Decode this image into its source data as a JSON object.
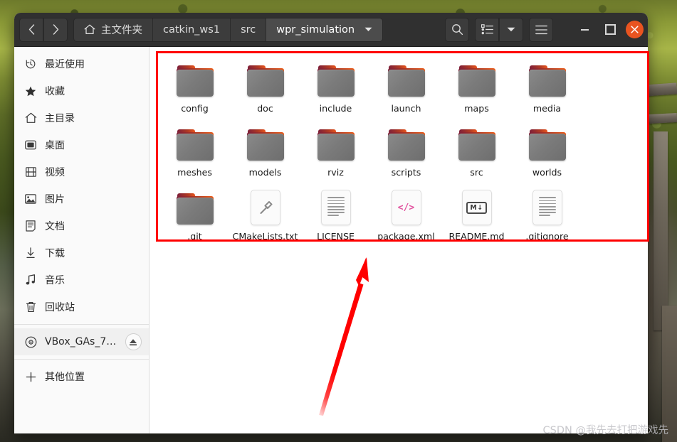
{
  "window": {
    "nav": {
      "back_label": "‹",
      "forward_label": "›"
    },
    "breadcrumb": [
      {
        "label": "主文件夹",
        "icon": "home-icon",
        "active": false
      },
      {
        "label": "catkin_ws1",
        "icon": "",
        "active": false
      },
      {
        "label": "src",
        "icon": "",
        "active": false
      },
      {
        "label": "wpr_simulation",
        "icon": "chevron-down-icon",
        "active": true
      }
    ],
    "toolbar": {
      "search_label": "search-icon",
      "view_list_label": "list-view-icon",
      "view_dropdown_label": "chevron-down-icon",
      "menu_label": "hamburger-menu-icon"
    },
    "controls": {
      "minimize_label": "minimize-icon",
      "maximize_label": "maximize-icon",
      "close_label": "close-icon",
      "close_color": "#e95420"
    }
  },
  "sidebar": {
    "items": [
      {
        "label": "最近使用",
        "icon": "clock-icon",
        "name": "recent"
      },
      {
        "label": "收藏",
        "icon": "star-icon",
        "name": "starred"
      },
      {
        "label": "主目录",
        "icon": "home-icon",
        "name": "home"
      },
      {
        "label": "桌面",
        "icon": "desktop-icon",
        "name": "desktop"
      },
      {
        "label": "视频",
        "icon": "video-icon",
        "name": "videos"
      },
      {
        "label": "图片",
        "icon": "image-icon",
        "name": "pictures"
      },
      {
        "label": "文档",
        "icon": "document-icon",
        "name": "documents"
      },
      {
        "label": "下载",
        "icon": "download-icon",
        "name": "downloads"
      },
      {
        "label": "音乐",
        "icon": "music-icon",
        "name": "music"
      },
      {
        "label": "回收站",
        "icon": "trash-icon",
        "name": "trash"
      }
    ],
    "drive": {
      "label": "VBox_GAs_7....",
      "icon": "disc-icon",
      "eject_label": "eject-icon"
    },
    "other_locations": {
      "label": "其他位置",
      "icon": "plus-icon"
    }
  },
  "files": [
    {
      "name": "config",
      "type": "folder"
    },
    {
      "name": "doc",
      "type": "folder"
    },
    {
      "name": "include",
      "type": "folder"
    },
    {
      "name": "launch",
      "type": "folder"
    },
    {
      "name": "maps",
      "type": "folder"
    },
    {
      "name": "media",
      "type": "folder"
    },
    {
      "name": "meshes",
      "type": "folder"
    },
    {
      "name": "models",
      "type": "folder"
    },
    {
      "name": "rviz",
      "type": "folder"
    },
    {
      "name": "scripts",
      "type": "folder"
    },
    {
      "name": "src",
      "type": "folder"
    },
    {
      "name": "worlds",
      "type": "folder"
    },
    {
      "name": ".git",
      "type": "folder"
    },
    {
      "name": "CMakeLists.txt",
      "type": "build"
    },
    {
      "name": "LICENSE",
      "type": "text"
    },
    {
      "name": "package.xml",
      "type": "code"
    },
    {
      "name": "README.md",
      "type": "markdown"
    },
    {
      "name": ".gitignore",
      "type": "text"
    }
  ],
  "annotations": {
    "highlight_box_color": "#ff0000",
    "arrow_color": "#ff0000"
  },
  "watermark": {
    "text": "CSDN @我先去打把游戏先"
  }
}
